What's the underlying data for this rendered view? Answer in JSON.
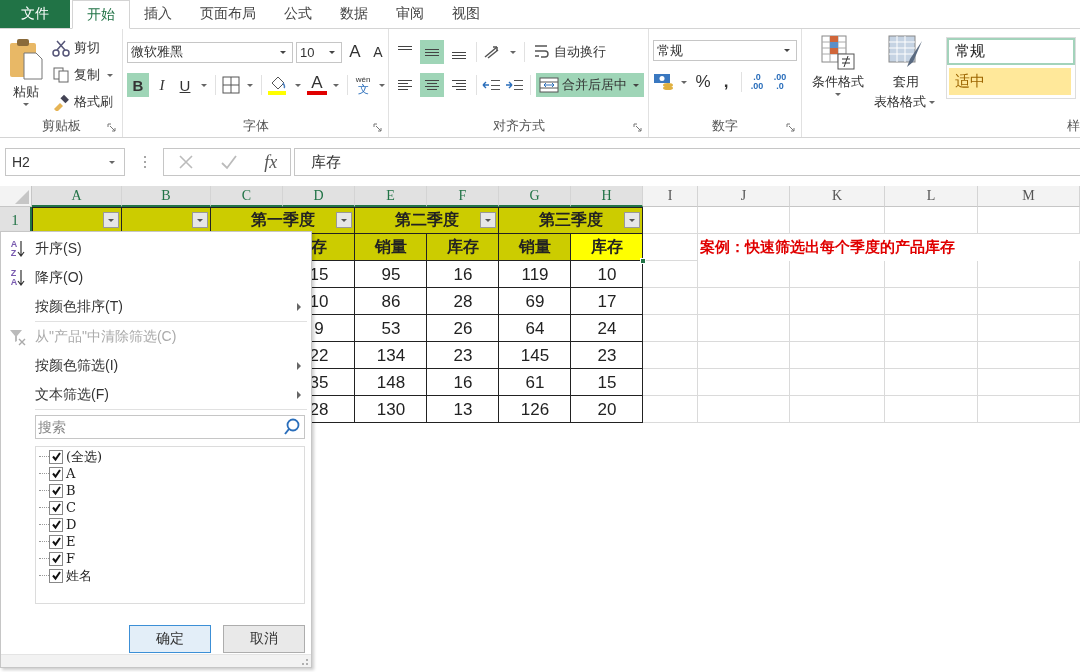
{
  "tabs": [
    {
      "label": "文件",
      "kind": "file",
      "selected": false
    },
    {
      "label": "开始",
      "kind": "tab",
      "selected": true
    },
    {
      "label": "插入",
      "kind": "tab",
      "selected": false
    },
    {
      "label": "页面布局",
      "kind": "tab",
      "selected": false
    },
    {
      "label": "公式",
      "kind": "tab",
      "selected": false
    },
    {
      "label": "数据",
      "kind": "tab",
      "selected": false
    },
    {
      "label": "审阅",
      "kind": "tab",
      "selected": false
    },
    {
      "label": "视图",
      "kind": "tab",
      "selected": false
    }
  ],
  "clipboard": {
    "paste": "粘贴",
    "cut": "剪切",
    "copy": "复制",
    "format_painter": "格式刷",
    "group_label": "剪贴板"
  },
  "font": {
    "name": "微软雅黑",
    "size": "10",
    "grow": "A",
    "shrink": "A",
    "bold": {
      "label": "B",
      "selected": true
    },
    "italic": {
      "label": "I",
      "selected": false
    },
    "underline": {
      "label": "U",
      "selected": false
    },
    "font_color": "A",
    "phonetic_top": "wén",
    "phonetic_bottom": "文",
    "group_label": "字体"
  },
  "alignment": {
    "vertical": [
      {
        "selected": false
      },
      {
        "selected": true
      },
      {
        "selected": false
      }
    ],
    "horizontal": [
      {
        "selected": false
      },
      {
        "selected": true
      },
      {
        "selected": false
      }
    ],
    "wrap_text": {
      "label": "自动换行",
      "selected": false
    },
    "merge_center": {
      "label": "合并后居中",
      "selected": true
    },
    "group_label": "对齐方式"
  },
  "number": {
    "format": "常规",
    "percent": "%",
    "comma": ",",
    "increase_decimal": [
      ".0",
      ".00"
    ],
    "decrease_decimal": [
      ".00",
      ".0"
    ],
    "group_label": "数字"
  },
  "styles": {
    "conditional": "条件格式",
    "table_format": [
      "套用",
      "表格格式"
    ],
    "gallery": [
      {
        "label": "常规",
        "kind": "normal"
      },
      {
        "label": "适中",
        "kind": "neutral"
      }
    ],
    "group_label": "样"
  },
  "formula_bar": {
    "name_box": "H2",
    "fx": "fx",
    "content": "库存"
  },
  "sheet": {
    "columns": [
      {
        "label": "A",
        "selected": true
      },
      {
        "label": "B",
        "selected": true
      },
      {
        "label": "C",
        "selected": true
      },
      {
        "label": "D",
        "selected": true
      },
      {
        "label": "E",
        "selected": true
      },
      {
        "label": "F",
        "selected": true
      },
      {
        "label": "G",
        "selected": true
      },
      {
        "label": "H",
        "selected": true
      },
      {
        "label": "I",
        "selected": false
      },
      {
        "label": "J",
        "selected": false
      },
      {
        "label": "K",
        "selected": false
      },
      {
        "label": "L",
        "selected": false
      },
      {
        "label": "M",
        "selected": false
      }
    ],
    "row_numbers": [
      {
        "label": "1",
        "selected": true
      }
    ],
    "header_row_1": [
      {
        "filter": true
      },
      {
        "filter": true
      },
      {
        "label": "第一季度",
        "filter": true
      },
      {
        "label": "第二季度",
        "filter": true
      },
      {
        "label": "第三季度",
        "filter": true
      }
    ],
    "header_row_2": [
      {
        "label": "存",
        "selected": false
      },
      {
        "label": "销量",
        "selected": false
      },
      {
        "label": "库存",
        "selected": false
      },
      {
        "label": "销量",
        "selected": false
      },
      {
        "label": "库存",
        "selected": true
      }
    ],
    "rows": [
      [
        "",
        "",
        "",
        "15",
        "95",
        "16",
        "119",
        "10"
      ],
      [
        "",
        "",
        "",
        "10",
        "86",
        "28",
        "69",
        "17"
      ],
      [
        "",
        "",
        "",
        "9",
        "53",
        "26",
        "64",
        "24"
      ],
      [
        "",
        "",
        "",
        "22",
        "134",
        "23",
        "145",
        "23"
      ],
      [
        "",
        "",
        "",
        "35",
        "148",
        "16",
        "61",
        "15"
      ],
      [
        "",
        "",
        "",
        "28",
        "130",
        "13",
        "126",
        "20"
      ]
    ]
  },
  "annotation": "案例：快速筛选出每个季度的产品库存",
  "filter_menu": {
    "items": [
      {
        "kind": "sort_asc",
        "label": "升序(S)",
        "icon_letters": [
          "A",
          "Z"
        ],
        "disabled": false,
        "submenu": false
      },
      {
        "kind": "sort_desc",
        "label": "降序(O)",
        "icon_letters": [
          "Z",
          "A"
        ],
        "disabled": false,
        "submenu": false
      },
      {
        "kind": "plain",
        "label": "按颜色排序(T)",
        "disabled": false,
        "submenu": true
      },
      {
        "kind": "clear",
        "label": "从\"产品\"中清除筛选(C)",
        "disabled": true,
        "submenu": false
      },
      {
        "kind": "plain",
        "label": "按颜色筛选(I)",
        "disabled": false,
        "submenu": true
      },
      {
        "kind": "plain",
        "label": "文本筛选(F)",
        "disabled": false,
        "submenu": true
      }
    ],
    "search": {
      "placeholder": "搜索"
    },
    "options": [
      {
        "label": "(全选)",
        "checked": true
      },
      {
        "label": "A",
        "checked": true
      },
      {
        "label": "B",
        "checked": true
      },
      {
        "label": "C",
        "checked": true
      },
      {
        "label": "D",
        "checked": true
      },
      {
        "label": "E",
        "checked": true
      },
      {
        "label": "F",
        "checked": true
      },
      {
        "label": "姓名",
        "checked": true
      }
    ],
    "buttons": [
      {
        "label": "确定",
        "kind": "default"
      },
      {
        "label": "取消",
        "kind": "normal"
      }
    ]
  }
}
